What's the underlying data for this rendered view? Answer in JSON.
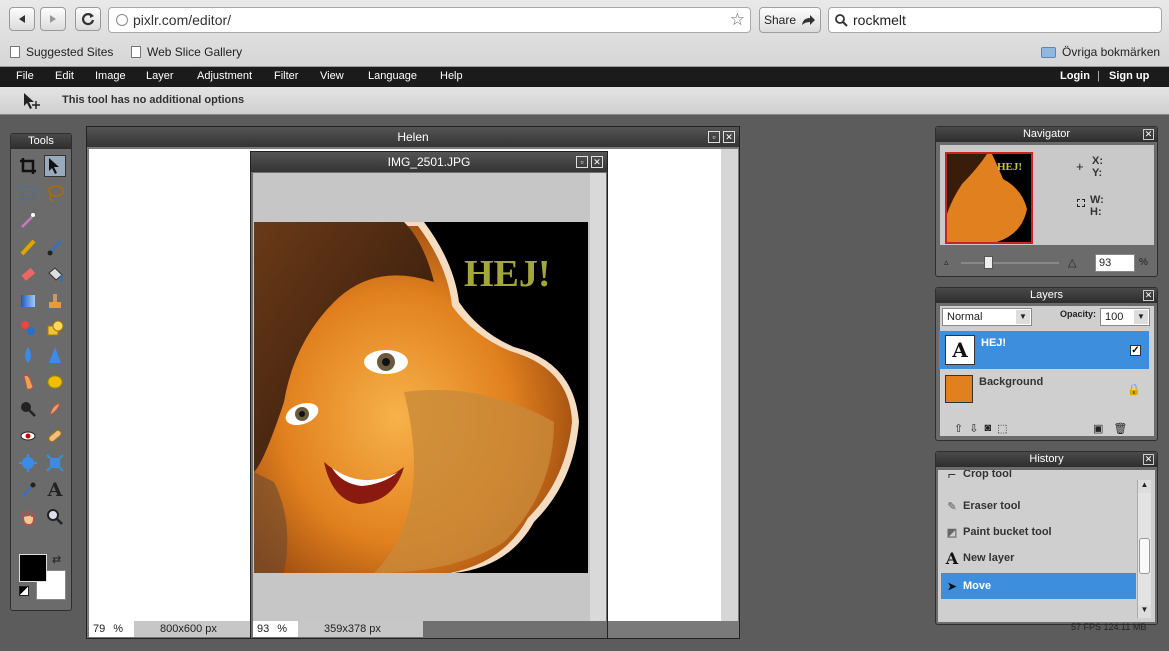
{
  "browser": {
    "url": "pixlr.com/editor/",
    "share_label": "Share",
    "search_value": "rockmelt",
    "bookmarks": [
      "Suggested Sites",
      "Web Slice Gallery"
    ],
    "other_bookmarks": "Övriga bokmärken"
  },
  "menu": {
    "items": [
      "File",
      "Edit",
      "Image",
      "Layer",
      "Adjustment",
      "Filter",
      "View",
      "Language",
      "Help"
    ],
    "login": "Login",
    "separator": "|",
    "signup": "Sign up"
  },
  "options": {
    "message": "This tool has no additional options"
  },
  "tools": {
    "title": "Tools"
  },
  "doc_helen": {
    "title": "Helen",
    "zoom": "79",
    "zoom_unit": "%",
    "size": "800x600 px"
  },
  "doc_img": {
    "title": "IMG_2501.JPG",
    "zoom": "93",
    "zoom_unit": "%",
    "size": "359x378 px",
    "overlay_text": "HEJ!"
  },
  "navigator": {
    "title": "Navigator",
    "x_label": "X:",
    "y_label": "Y:",
    "w_label": "W:",
    "h_label": "H:",
    "zoom": "93",
    "zoom_unit": "%",
    "thumb_text": "HEJ!"
  },
  "layers": {
    "title": "Layers",
    "blend_mode": "Normal",
    "opacity_label": "Opacity:",
    "opacity_value": "100",
    "items": [
      {
        "name": "HEJ!",
        "thumb": "A",
        "selected": true
      },
      {
        "name": "Background",
        "selected": false
      }
    ]
  },
  "history": {
    "title": "History",
    "items": [
      "Crop tool",
      "Eraser tool",
      "Paint bucket tool",
      "New layer",
      "Move"
    ]
  },
  "footer": {
    "fps": "57 FPS 124.11 MB"
  },
  "colors": {
    "accent": "#3d8fdd",
    "panel_title": "#2d2d2d",
    "menubar": "#1b1b1b"
  }
}
